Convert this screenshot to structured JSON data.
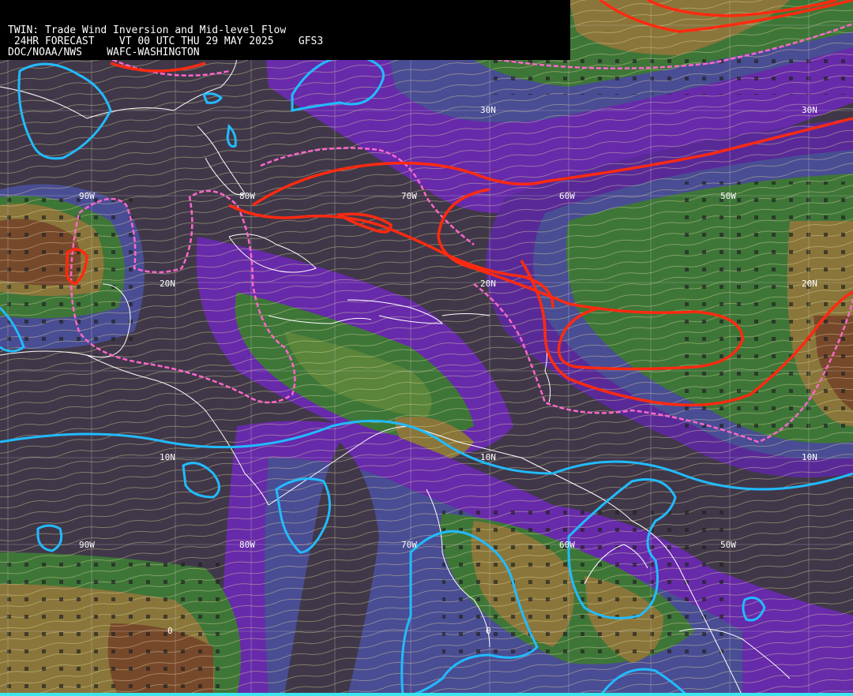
{
  "header": {
    "line1": "TWIN: Trade Wind Inversion and Mid-level Flow",
    "line2": " 24HR FORECAST    VT 00 UTC THU 29 MAY 2025    GFS3",
    "line3": "DOC/NOAA/NWS    WAFC-WASHINGTON"
  },
  "grid_labels": {
    "lat": [
      "30N",
      "30N",
      "20N",
      "20N",
      "20N",
      "10N",
      "10N",
      "10N",
      "0",
      "0"
    ],
    "lon": [
      "90W",
      "80W",
      "70W",
      "60W",
      "50W",
      "90W",
      "80W",
      "70W",
      "60W",
      "50W"
    ]
  },
  "map_legend_colors": {
    "background": "#403848",
    "purple": "#7a2ac0",
    "blue": "#4a4f98",
    "green": "#3e7a38",
    "lightgreen": "#5c8a3a",
    "olive": "#8e7a3a",
    "brown": "#7a4a2a",
    "cyan_contour": "#22bbff",
    "red_contour": "#ff2a10",
    "pink_dash": "#ff66cc",
    "streamline": "#e8e0a0",
    "coast": "#ffffff"
  }
}
